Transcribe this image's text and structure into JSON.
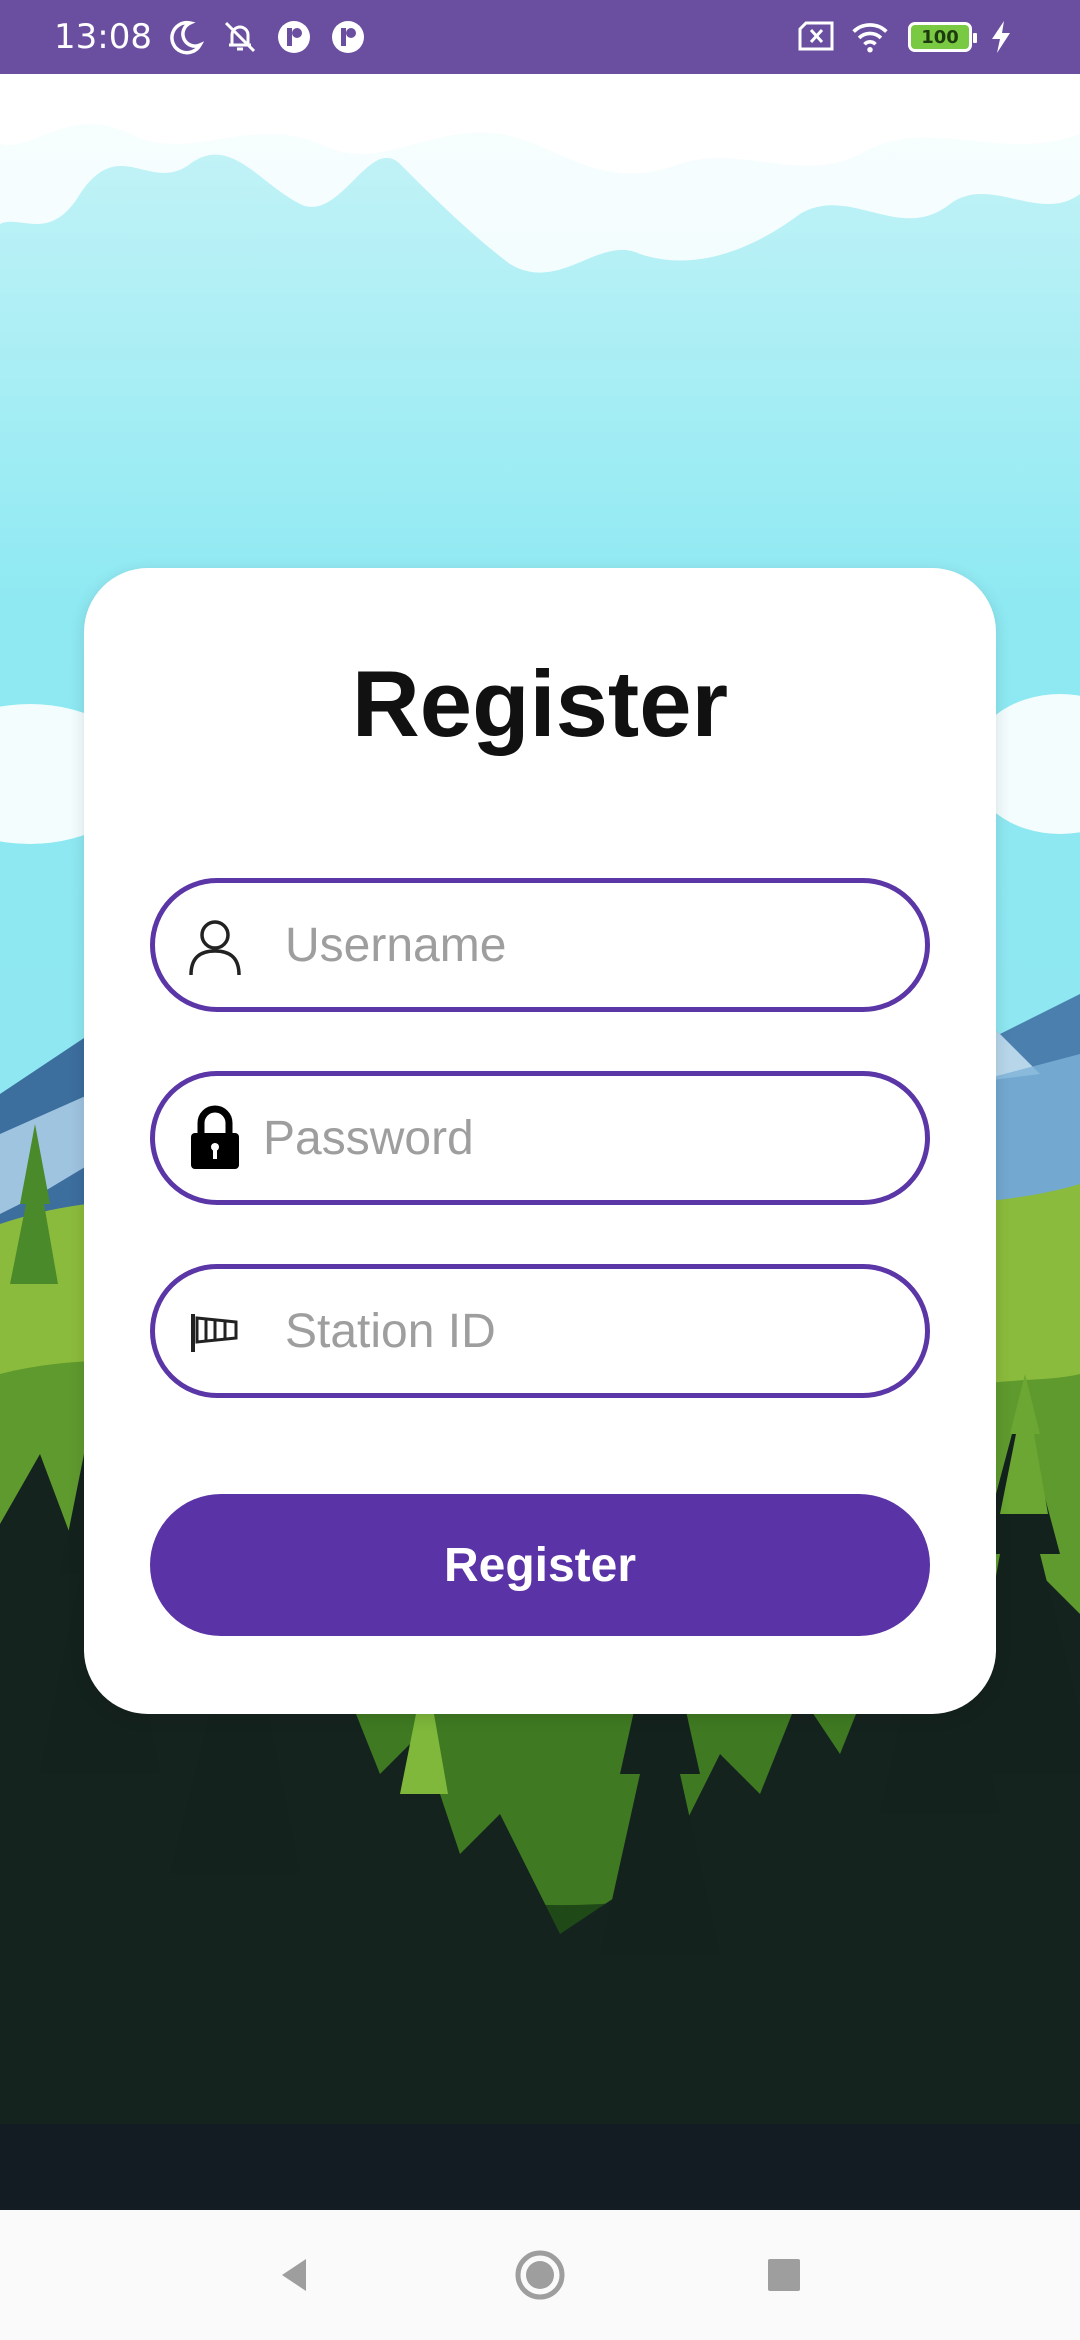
{
  "status_bar": {
    "time": "13:08",
    "battery_level": "100",
    "icons": [
      "moon-icon",
      "silent-bell-icon",
      "app-notification-icon",
      "app-notification-icon",
      "sim-x-icon",
      "wifi-icon",
      "battery-icon",
      "charging-bolt-icon"
    ]
  },
  "card": {
    "title": "Register",
    "fields": [
      {
        "icon": "user-icon",
        "placeholder": "Username",
        "value": ""
      },
      {
        "icon": "lock-icon",
        "placeholder": "Password",
        "value": ""
      },
      {
        "icon": "windsock-icon",
        "placeholder": "Station ID",
        "value": ""
      }
    ],
    "submit_label": "Register"
  },
  "nav_bar": {
    "icons": [
      "back-icon",
      "home-icon",
      "recents-icon"
    ]
  },
  "colors": {
    "accent": "#5a33a7",
    "status_bar": "#6a4fa0",
    "sky": "#8ee9f2"
  }
}
